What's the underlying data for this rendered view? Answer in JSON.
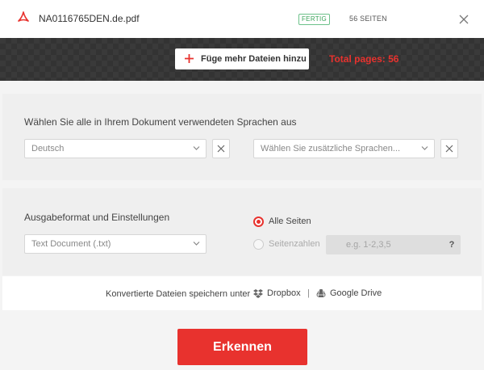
{
  "file": {
    "name": "NA0116765DEN.de.pdf",
    "status": "FERTIG",
    "pages": "56 SEITEN"
  },
  "toolbar": {
    "add_files_label": "Füge mehr Dateien hinzu",
    "total_pages": "Total pages: 56"
  },
  "languages": {
    "title": "Wählen Sie alle in Ihrem Dokument verwendeten Sprachen aus",
    "primary_value": "Deutsch",
    "additional_placeholder": "Wählen Sie zusätzliche Sprachen..."
  },
  "output": {
    "title": "Ausgabeformat und Einstellungen",
    "format_value": "Text Document (.txt)",
    "all_pages_label": "Alle Seiten",
    "page_numbers_label": "Seitenzahlen",
    "page_range_placeholder": "e.g. 1-2,3,5",
    "help_label": "?",
    "selected_option": "Alle Seiten"
  },
  "save": {
    "label": "Konvertierte Dateien speichern unter",
    "dropbox_label": "Dropbox",
    "separator": "|",
    "gdrive_label": "Google Drive"
  },
  "action": {
    "recognize_label": "Erkennen"
  },
  "icons": {
    "file": "pdf-icon",
    "close": "close-icon",
    "add": "plus-icon",
    "clear": "close-icon",
    "dropdown": "chevron-down-icon",
    "dropbox": "dropbox-icon",
    "gdrive": "google-drive-icon"
  },
  "colors": {
    "accent": "#e8322e",
    "status_green": "#3aa35a",
    "dark_band": "#3a3a3a",
    "panel_bg": "#efefef",
    "page_bg": "#f4f4f4"
  }
}
